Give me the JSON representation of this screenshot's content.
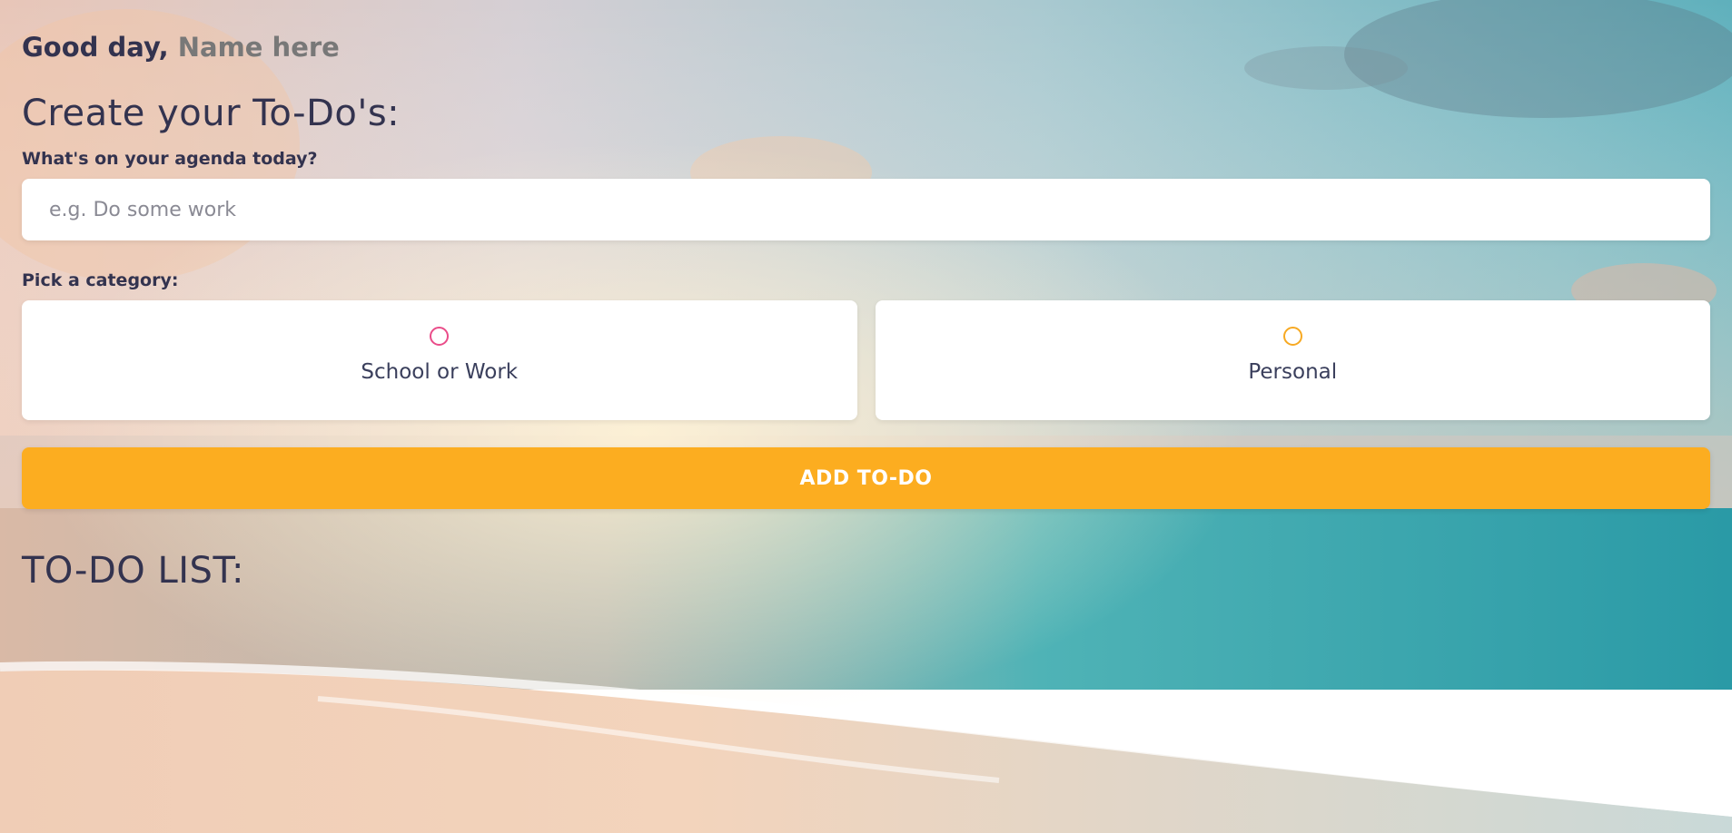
{
  "greeting": {
    "prefix": "Good day,",
    "name": "Name here"
  },
  "create_section": {
    "title": "Create your To-Do's:",
    "input_label": "What's on your agenda today?",
    "input_placeholder": "e.g. Do some work",
    "input_value": ""
  },
  "category_section": {
    "label": "Pick a category:",
    "options": [
      {
        "label": "School or Work",
        "color": "#ea4c89",
        "selected": false
      },
      {
        "label": "Personal",
        "color": "#f7a922",
        "selected": false
      }
    ]
  },
  "add_button": {
    "label": "ADD TO-DO",
    "color": "#fcad20"
  },
  "list_section": {
    "title": "TO-DO LIST:",
    "items": []
  }
}
